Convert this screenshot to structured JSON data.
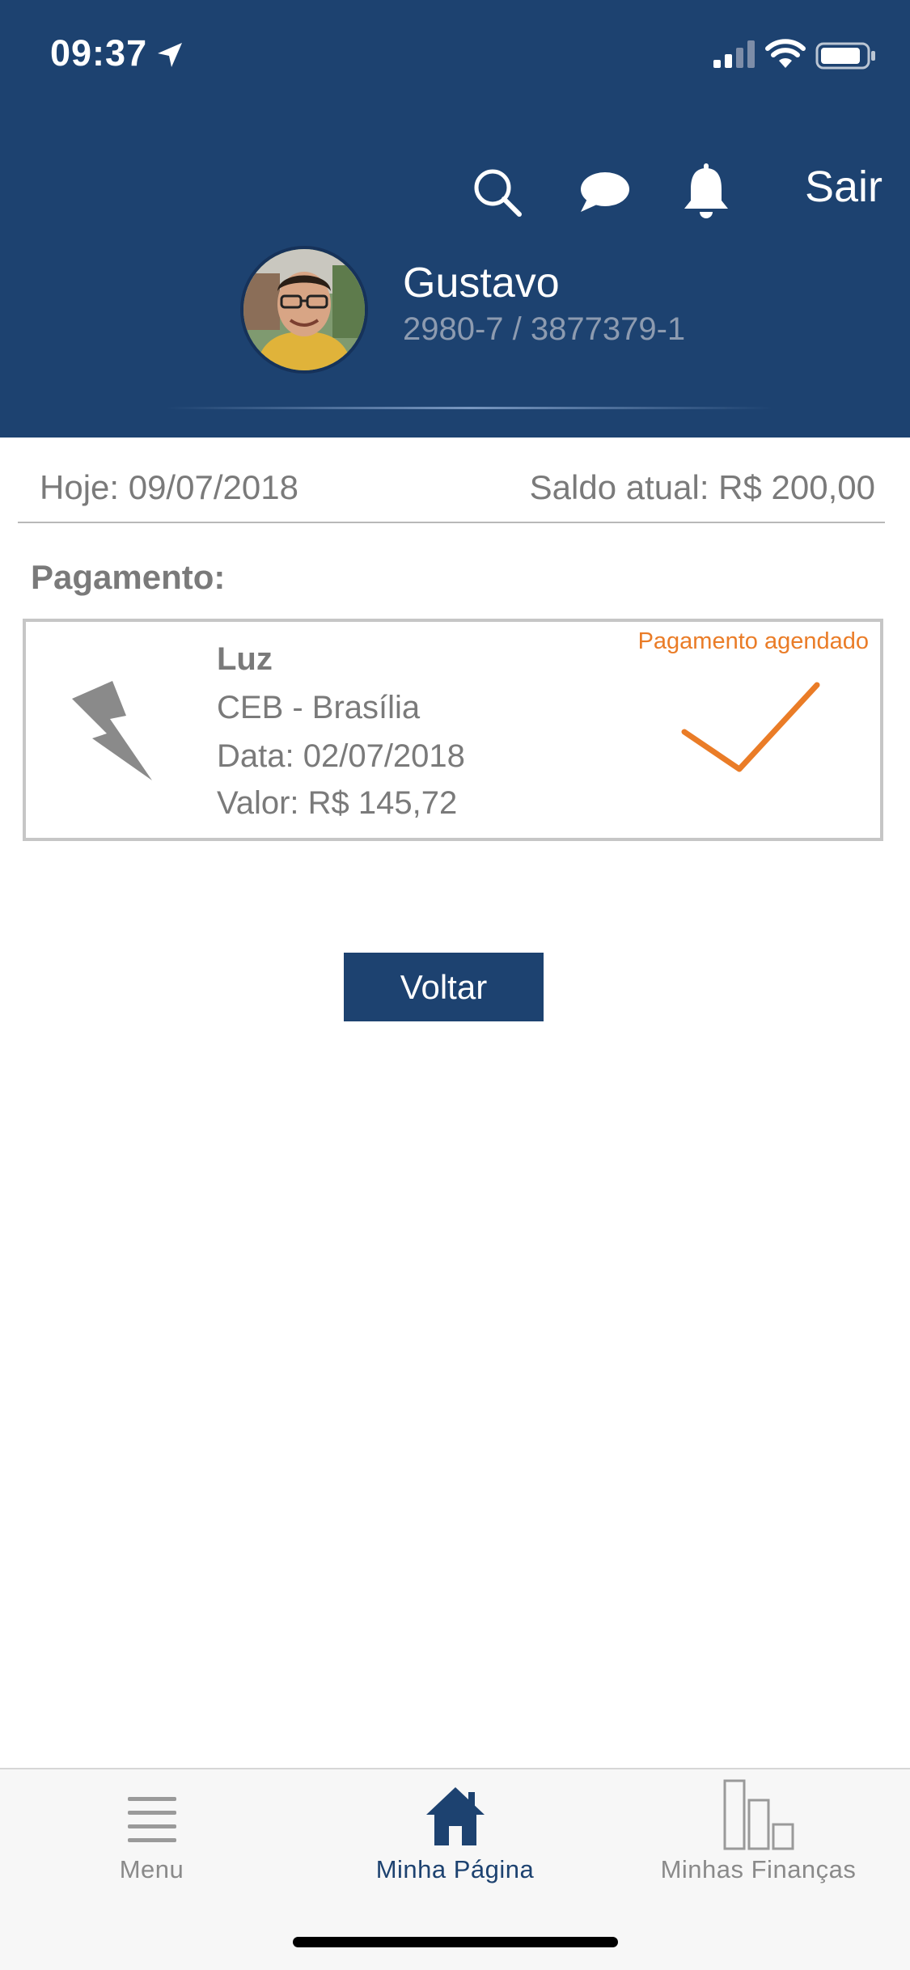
{
  "status_bar": {
    "time": "09:37",
    "icons": [
      "location-arrow-icon",
      "signal-icon",
      "wifi-icon",
      "battery-icon"
    ]
  },
  "header": {
    "icons": [
      "search-icon",
      "chat-icon",
      "bell-icon"
    ],
    "logout_label": "Sair",
    "user": {
      "name": "Gustavo",
      "account": "2980-7 / 3877379-1"
    },
    "background_color": "#1d4270"
  },
  "info": {
    "today": "Hoje: 09/07/2018",
    "balance": "Saldo atual: R$ 200,00"
  },
  "section_title": "Pagamento:",
  "payment": {
    "icon": "lightning-bolt-icon",
    "name": "Luz",
    "company": "CEB - Brasília",
    "date": "Data: 02/07/2018",
    "value": "Valor: R$ 145,72",
    "status": "Pagamento agendado",
    "status_icon": "checkmark-icon",
    "status_color": "#ea7c27"
  },
  "back_button": "Voltar",
  "tab_bar": {
    "items": [
      {
        "label": "Menu",
        "icon": "hamburger-icon",
        "active": false
      },
      {
        "label": "Minha Página",
        "icon": "home-icon",
        "active": true
      },
      {
        "label": "Minhas Finanças",
        "icon": "bar-chart-icon",
        "active": false
      }
    ]
  }
}
